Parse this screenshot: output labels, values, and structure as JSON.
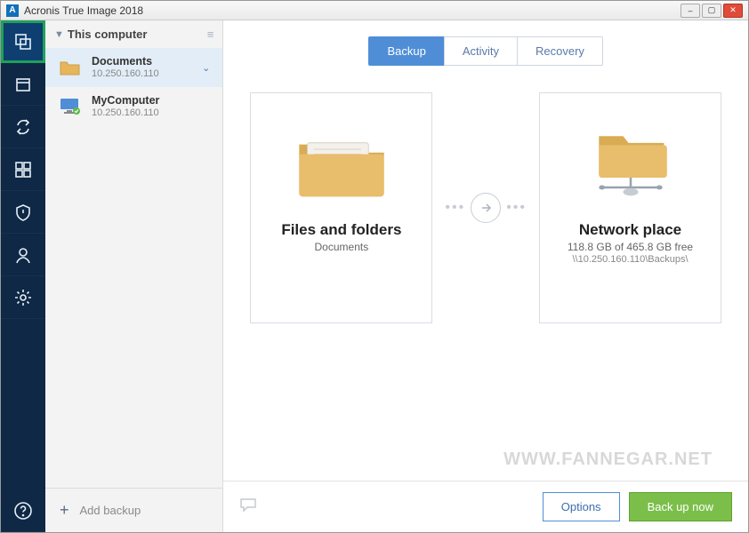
{
  "window": {
    "title": "Acronis True Image 2018",
    "app_icon_letter": "A"
  },
  "sidebar": {
    "header": "This computer",
    "items": [
      {
        "title": "Documents",
        "sub": "10.250.160.110",
        "selected": true,
        "type": "folder"
      },
      {
        "title": "MyComputer",
        "sub": "10.250.160.110",
        "selected": false,
        "type": "pc"
      }
    ],
    "add_label": "Add backup"
  },
  "tabs": {
    "backup": "Backup",
    "activity": "Activity",
    "recovery": "Recovery"
  },
  "source_card": {
    "title": "Files and folders",
    "sub": "Documents"
  },
  "dest_card": {
    "title": "Network place",
    "sub1": "118.8 GB of 465.8 GB free",
    "sub2": "\\\\10.250.160.110\\Backups\\"
  },
  "buttons": {
    "options": "Options",
    "backup_now": "Back up now"
  },
  "watermark": "WWW.FANNEGAR.NET"
}
